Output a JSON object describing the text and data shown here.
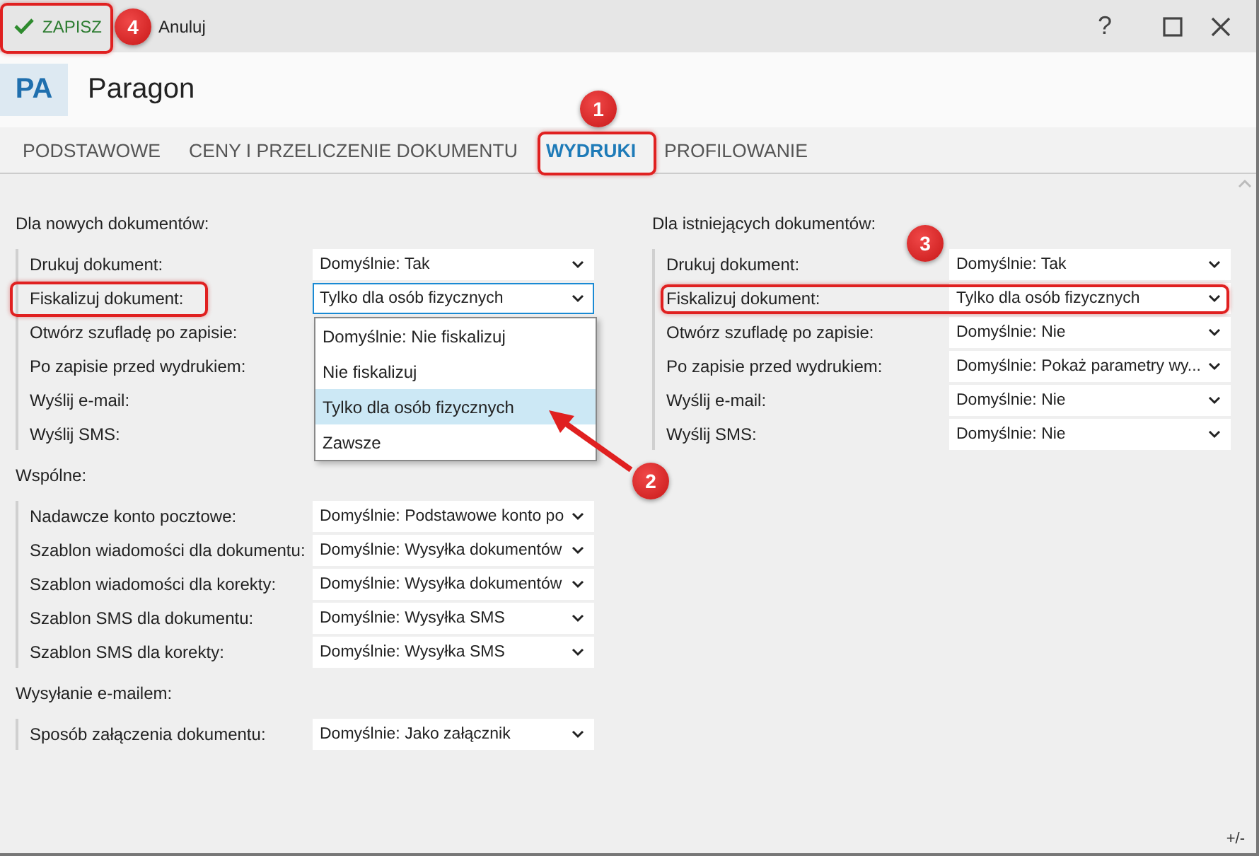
{
  "toolbar": {
    "save": "ZAPISZ",
    "cancel": "Anuluj",
    "help": "?"
  },
  "header": {
    "badge": "PA",
    "title": "Paragon"
  },
  "tabs": [
    {
      "label": "PODSTAWOWE",
      "selected": false
    },
    {
      "label": "CENY I PRZELICZENIE DOKUMENTU",
      "selected": false
    },
    {
      "label": "WYDRUKI",
      "selected": true
    },
    {
      "label": "PROFILOWANIE",
      "selected": false
    }
  ],
  "columns": [
    {
      "sections": [
        {
          "title": "Dla nowych dokumentów:",
          "rows": [
            {
              "label": "Drukuj dokument:",
              "value": "Domyślnie: Tak",
              "open": false
            },
            {
              "label": "Fiskalizuj dokument:",
              "value": "Tylko dla osób fizycznych",
              "open": true,
              "options": [
                {
                  "label": "Domyślnie: Nie fiskalizuj",
                  "selected": false
                },
                {
                  "label": "Nie fiskalizuj",
                  "selected": false
                },
                {
                  "label": "Tylko dla osób fizycznych",
                  "selected": true
                },
                {
                  "label": "Zawsze",
                  "selected": false
                }
              ]
            },
            {
              "label": "Otwórz szufladę po zapisie:"
            },
            {
              "label": "Po zapisie przed wydrukiem:"
            },
            {
              "label": "Wyślij e-mail:"
            },
            {
              "label": "Wyślij SMS:"
            }
          ]
        },
        {
          "title": "Wspólne:",
          "rows": [
            {
              "label": "Nadawcze konto pocztowe:",
              "value": "Domyślnie: Podstawowe konto po",
              "open": false
            },
            {
              "label": "Szablon wiadomości dla dokumentu:",
              "value": "Domyślnie: Wysyłka dokumentów",
              "open": false
            },
            {
              "label": "Szablon wiadomości dla korekty:",
              "value": "Domyślnie: Wysyłka dokumentów",
              "open": false
            },
            {
              "label": "Szablon SMS dla dokumentu:",
              "value": "Domyślnie: Wysyłka SMS",
              "open": false
            },
            {
              "label": "Szablon SMS dla korekty:",
              "value": "Domyślnie: Wysyłka SMS",
              "open": false
            }
          ]
        },
        {
          "title": "Wysyłanie e-mailem:",
          "rows": [
            {
              "label": "Sposób załączenia dokumentu:",
              "value": "Domyślnie: Jako załącznik",
              "open": false
            }
          ]
        }
      ]
    },
    {
      "sections": [
        {
          "title": "Dla istniejących dokumentów:",
          "rows": [
            {
              "label": "Drukuj dokument:",
              "value": "Domyślnie: Tak",
              "open": false
            },
            {
              "label": "Fiskalizuj dokument:",
              "value": "Tylko dla osób fizycznych",
              "open": false
            },
            {
              "label": "Otwórz szufladę po zapisie:",
              "value": "Domyślnie: Nie",
              "open": false
            },
            {
              "label": "Po zapisie przed wydrukiem:",
              "value": "Domyślnie: Pokaż parametry wy...",
              "open": false
            },
            {
              "label": "Wyślij e-mail:",
              "value": "Domyślnie: Nie",
              "open": false
            },
            {
              "label": "Wyślij SMS:",
              "value": "Domyślnie: Nie",
              "open": false
            }
          ]
        }
      ]
    }
  ],
  "footer": "+/-",
  "annotations": {
    "markers": [
      "1",
      "2",
      "3",
      "4"
    ]
  }
}
